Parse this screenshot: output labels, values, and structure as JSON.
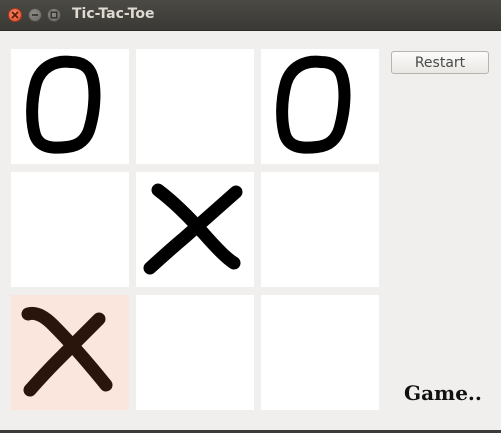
{
  "window": {
    "title": "Tic-Tac-Toe"
  },
  "board": {
    "cells": [
      {
        "mark": "O",
        "highlighted": false
      },
      {
        "mark": "",
        "highlighted": false
      },
      {
        "mark": "O",
        "highlighted": false
      },
      {
        "mark": "",
        "highlighted": false
      },
      {
        "mark": "X",
        "highlighted": false
      },
      {
        "mark": "",
        "highlighted": false
      },
      {
        "mark": "X",
        "highlighted": true
      },
      {
        "mark": "",
        "highlighted": false
      },
      {
        "mark": "",
        "highlighted": false
      }
    ]
  },
  "controls": {
    "restart_label": "Restart"
  },
  "status": {
    "text": "Game.."
  },
  "colors": {
    "mark": "#000000",
    "highlight_mark": "#2a150c",
    "highlight_cell": "#fbe6de"
  }
}
